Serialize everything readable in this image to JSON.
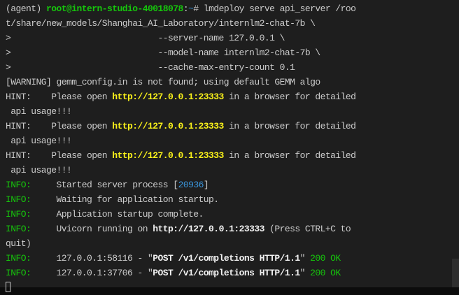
{
  "colors": {
    "background": "#1e1e1e",
    "text": "#cccccc",
    "green": "#16c60c",
    "yellow": "#f9f11a",
    "blue": "#3a96dd"
  },
  "lines": [
    [
      {
        "t": "(agent) ",
        "c": "n"
      },
      {
        "t": "root@intern-studio-40018078",
        "c": "gb"
      },
      {
        "t": ":",
        "c": "n"
      },
      {
        "t": "~",
        "c": "b"
      },
      {
        "t": "# lmdeploy serve api_server /roo",
        "c": "n"
      }
    ],
    [
      {
        "t": "t/share/new_models/Shanghai_AI_Laboratory/internlm2-chat-7b \\",
        "c": "n"
      }
    ],
    [
      {
        "t": ">                             --server-name 127.0.0.1 \\",
        "c": "n"
      }
    ],
    [
      {
        "t": ">                             --model-name internlm2-chat-7b \\",
        "c": "n"
      }
    ],
    [
      {
        "t": ">                             --cache-max-entry-count 0.1",
        "c": "n"
      }
    ],
    [
      {
        "t": "[WARNING] gemm_config.in is not found; using default GEMM algo",
        "c": "n"
      }
    ],
    [
      {
        "t": "HINT:    Please open ",
        "c": "n"
      },
      {
        "t": "http://127.0.0.1:23333",
        "c": "y"
      },
      {
        "t": " in a browser for detailed",
        "c": "n"
      }
    ],
    [
      {
        "t": " api usage!!!",
        "c": "n"
      }
    ],
    [
      {
        "t": "HINT:    Please open ",
        "c": "n"
      },
      {
        "t": "http://127.0.0.1:23333",
        "c": "y"
      },
      {
        "t": " in a browser for detailed",
        "c": "n"
      }
    ],
    [
      {
        "t": " api usage!!!",
        "c": "n"
      }
    ],
    [
      {
        "t": "HINT:    Please open ",
        "c": "n"
      },
      {
        "t": "http://127.0.0.1:23333",
        "c": "y"
      },
      {
        "t": " in a browser for detailed",
        "c": "n"
      }
    ],
    [
      {
        "t": " api usage!!!",
        "c": "n"
      }
    ],
    [
      {
        "t": "INFO:",
        "c": "g"
      },
      {
        "t": "     Started server process [",
        "c": "n"
      },
      {
        "t": "20936",
        "c": "b"
      },
      {
        "t": "]",
        "c": "n"
      }
    ],
    [
      {
        "t": "INFO:",
        "c": "g"
      },
      {
        "t": "     Waiting for application startup.",
        "c": "n"
      }
    ],
    [
      {
        "t": "INFO:",
        "c": "g"
      },
      {
        "t": "     Application startup complete.",
        "c": "n"
      }
    ],
    [
      {
        "t": "INFO:",
        "c": "g"
      },
      {
        "t": "     Uvicorn running on ",
        "c": "n"
      },
      {
        "t": "http://127.0.0.1:23333",
        "c": "w"
      },
      {
        "t": " (Press CTRL+C to",
        "c": "n"
      }
    ],
    [
      {
        "t": "quit)",
        "c": "n"
      }
    ],
    [
      {
        "t": "INFO:",
        "c": "g"
      },
      {
        "t": "     127.0.0.1:58116 - \"",
        "c": "n"
      },
      {
        "t": "POST /v1/completions HTTP/1.1",
        "c": "w"
      },
      {
        "t": "\" ",
        "c": "n"
      },
      {
        "t": "200 OK",
        "c": "g"
      }
    ],
    [
      {
        "t": "INFO:",
        "c": "g"
      },
      {
        "t": "     127.0.0.1:37706 - \"",
        "c": "n"
      },
      {
        "t": "POST /v1/completions HTTP/1.1",
        "c": "w"
      },
      {
        "t": "\" ",
        "c": "n"
      },
      {
        "t": "200 OK",
        "c": "g"
      }
    ]
  ]
}
